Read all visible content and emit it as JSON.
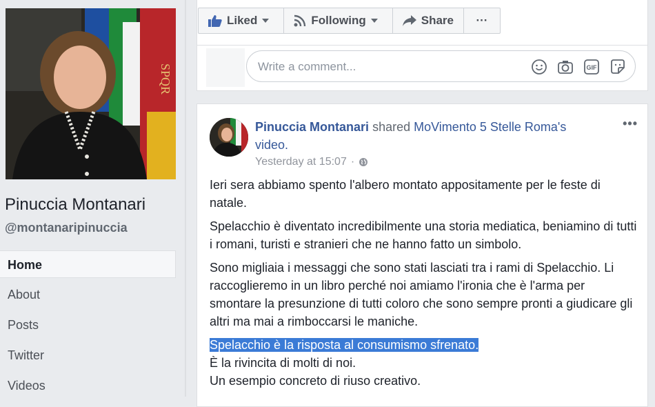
{
  "sidebar": {
    "page_name": "Pinuccia Montanari",
    "handle": "@montanaripinuccia",
    "nav": [
      "Home",
      "About",
      "Posts",
      "Twitter",
      "Videos"
    ]
  },
  "actions": {
    "liked": "Liked",
    "following": "Following",
    "share": "Share",
    "more": "···"
  },
  "comment": {
    "placeholder": "Write a comment..."
  },
  "post": {
    "author": "Pinuccia Montanari",
    "shared_text": "shared",
    "target": "MoVimento 5 Stelle Roma's",
    "media": "video.",
    "timestamp": "Yesterday at 15:07",
    "meta_sep": "·",
    "more": "•••",
    "paragraphs": [
      "Ieri sera abbiamo spento l'albero montato appositamente per le feste di natale.",
      "Spelacchio è diventato incredibilmente una storia mediatica, beniamino di tutti i romani, turisti e stranieri che ne hanno fatto un simbolo.",
      "Sono migliaia i messaggi che sono stati lasciati tra i rami di Spelacchio. Li raccoglieremo in un libro perché noi amiamo l'ironia che è l'arma per smontare la presunzione di tutti coloro che sono sempre pronti a giudicare gli altri ma mai a rimboccarsi le maniche."
    ],
    "highlighted": "Spelacchio è la risposta al consumismo sfrenato.",
    "line2": "È la rivincita di molti di noi.",
    "line3": "Un esempio concreto di riuso creativo."
  },
  "colors": {
    "link": "#365899",
    "selection": "#3b7bd6",
    "background": "#e9ebee"
  }
}
